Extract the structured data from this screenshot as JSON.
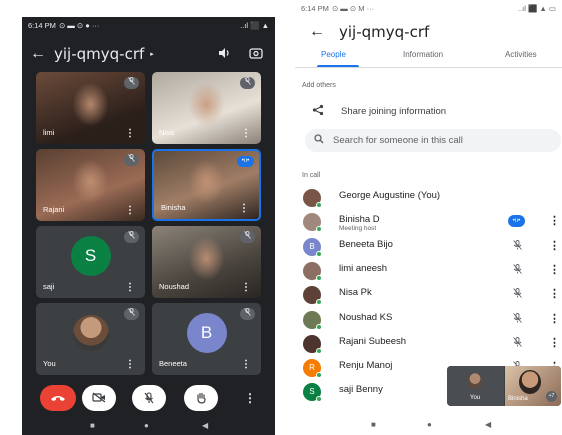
{
  "left_screen": {
    "status": {
      "time": "6:14 PM",
      "icons": "⊙ ▬ ⊙ ● ···",
      "right": "..ıl ⬛ ▲"
    },
    "header": {
      "back_icon": "←",
      "title": "yij-qmyq-crf",
      "caret": "▸",
      "speaker_icon": "🔈",
      "flip_icon": "⟲"
    },
    "tiles": [
      {
        "name": "limi",
        "kind": "photo",
        "muted": true
      },
      {
        "name": "Nisa",
        "kind": "photo",
        "muted": true
      },
      {
        "name": "Rajani",
        "kind": "photo",
        "muted": true
      },
      {
        "name": "Binisha",
        "kind": "photo",
        "speaking": true
      },
      {
        "name": "saji",
        "kind": "avatar",
        "letter": "S",
        "color": "#0b8043",
        "muted": true
      },
      {
        "name": "Noushad",
        "kind": "photo",
        "muted": true
      },
      {
        "name": "You",
        "kind": "photo-small",
        "muted": true
      },
      {
        "name": "Beneeta",
        "kind": "avatar",
        "letter": "B",
        "color": "#7986cb",
        "muted": true
      }
    ],
    "menu_glyph": "⋮",
    "mute_glyph": "🎙̸",
    "controls": {
      "end_call_icon": "end-call-icon",
      "camera_icon": "camera-off-icon",
      "mic_icon": "mic-off-icon",
      "hand_icon": "raise-hand-icon",
      "more_icon": "more-options-icon"
    },
    "nav": {
      "square": "■",
      "circle": "●",
      "triangle": "◀"
    }
  },
  "right_screen": {
    "status": {
      "time": "6:14 PM",
      "icons": "⊙ ▬ ⊙ M ···",
      "right": "..ıl ⬛ ▲ ▭"
    },
    "header": {
      "back_icon": "←",
      "title": "yij-qmyq-crf"
    },
    "tabs": [
      "People",
      "Information",
      "Activities"
    ],
    "active_tab": "People",
    "add_others_label": "Add others",
    "share_label": "Share joining information",
    "search_placeholder": "Search for someone in this call",
    "in_call_label": "In call",
    "participants": [
      {
        "name": "George Augustine (You)",
        "avatar": "photo",
        "color": "#795548",
        "mic": "none",
        "menu": false
      },
      {
        "name": "Binisha D",
        "subtitle": "Meeting host",
        "avatar": "photo",
        "color": "#a1887f",
        "mic": "speaking",
        "menu": true
      },
      {
        "name": "Beneeta Bijo",
        "avatar": "B",
        "color": "#7986cb",
        "mic": "muted",
        "menu": true
      },
      {
        "name": "limi aneesh",
        "avatar": "photo",
        "color": "#8d6e63",
        "mic": "muted",
        "menu": true
      },
      {
        "name": "Nisa Pk",
        "avatar": "photo",
        "color": "#5d4037",
        "mic": "muted",
        "menu": true
      },
      {
        "name": "Noushad KS",
        "avatar": "photo",
        "color": "#6d7a55",
        "mic": "muted",
        "menu": true
      },
      {
        "name": "Rajani Subeesh",
        "avatar": "photo",
        "color": "#4e342e",
        "mic": "muted",
        "menu": true
      },
      {
        "name": "Renju Manoj",
        "avatar": "R",
        "color": "#f57c00",
        "mic": "muted",
        "menu": true
      },
      {
        "name": "saji Benny",
        "avatar": "S",
        "color": "#0b8043",
        "mic": "muted",
        "menu": true
      }
    ],
    "pip": {
      "you_label": "You",
      "other_label": "Binisha",
      "count": "+7"
    },
    "nav": {
      "square": "■",
      "circle": "●",
      "triangle": "◀"
    }
  }
}
